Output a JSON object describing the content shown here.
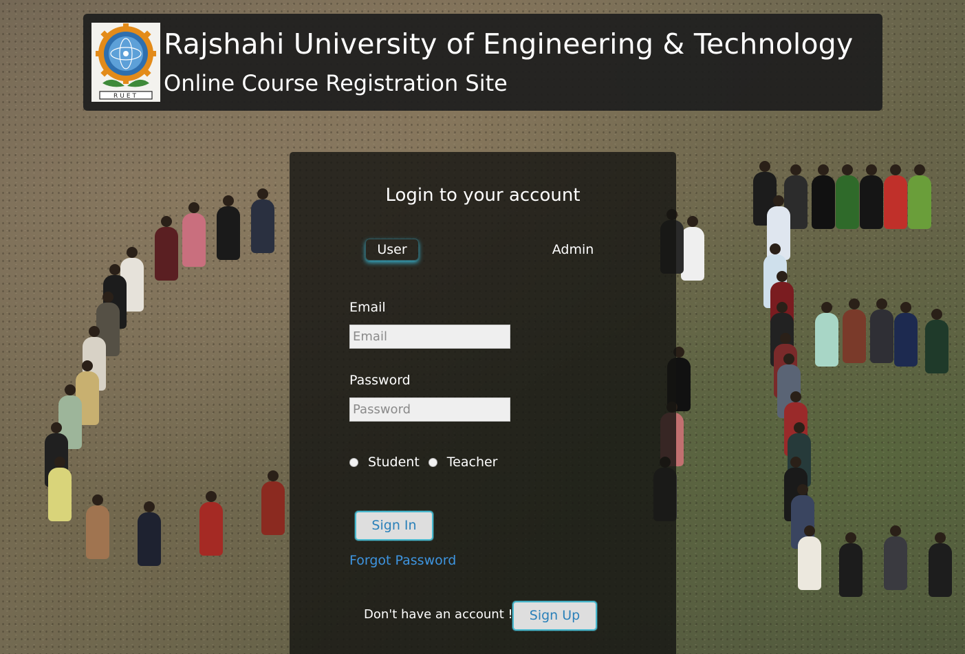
{
  "header": {
    "title": "Rajshahi University of Engineering & Technology",
    "subtitle": "Online Course Registration Site",
    "logo_text": "RUET"
  },
  "login": {
    "heading": "Login to your account",
    "tabs": [
      {
        "label": "User",
        "active": true
      },
      {
        "label": "Admin",
        "active": false
      }
    ],
    "email_label": "Email",
    "email_placeholder": "Email",
    "password_label": "Password",
    "password_placeholder": "Password",
    "roles": [
      {
        "label": "Student",
        "checked": false
      },
      {
        "label": "Teacher",
        "checked": false
      }
    ],
    "signin_label": "Sign In",
    "forgot_label": "Forgot Password",
    "signup_prompt": "Don't have an account !",
    "signup_label": "Sign Up"
  },
  "colors": {
    "accent": "#49b9cf",
    "link": "#3e95e0",
    "button_text": "#2a80b9",
    "panel_bg": "#141412"
  }
}
